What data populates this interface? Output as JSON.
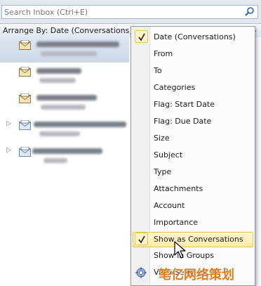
{
  "search": {
    "placeholder": "Search Inbox (Ctrl+E)"
  },
  "arrange": {
    "label": "Arrange By: Date (Conversations)"
  },
  "menu": {
    "items": [
      {
        "label": "Date (Conversations)",
        "checked": true
      },
      {
        "label": "From"
      },
      {
        "label": "To"
      },
      {
        "label": "Categories"
      },
      {
        "label": "Flag: Start Date"
      },
      {
        "label": "Flag: Due Date"
      },
      {
        "label": "Size"
      },
      {
        "label": "Subject"
      },
      {
        "label": "Type"
      },
      {
        "label": "Attachments"
      },
      {
        "label": "Account"
      },
      {
        "label": "Importance"
      },
      {
        "label": "Show as Conversations",
        "checked": true,
        "highlighted": true
      },
      {
        "label": "Show in Groups"
      },
      {
        "label": "View Settings..."
      }
    ]
  },
  "watermark": {
    "text": "笔亿网络策划"
  },
  "colors": {
    "menu_highlight": "#fde9a2",
    "check_border": "#e3c36b",
    "selected_row": "#cdd7e6",
    "watermark": "#e07c1d"
  }
}
